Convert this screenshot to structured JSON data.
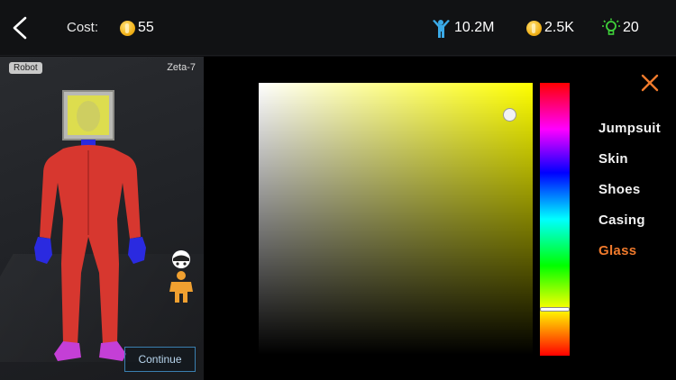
{
  "topbar": {
    "cost_label": "Cost:",
    "cost_value": "55",
    "fans_value": "10.2M",
    "coins_value": "2.5K",
    "ideas_value": "20",
    "icons": [
      "back-arrow-icon",
      "coin-icon",
      "fans-icon",
      "bulb-icon"
    ]
  },
  "preview": {
    "type_badge": "Robot",
    "character_name": "Zeta-7",
    "continue_label": "Continue",
    "icons": [
      "pose-icon"
    ]
  },
  "picker": {
    "hue_color": "#ffff00",
    "selected_hex": "#e8e8d8",
    "hue_position": 0.83
  },
  "parts": {
    "items": [
      {
        "label": "Jumpsuit",
        "active": false
      },
      {
        "label": "Skin",
        "active": false
      },
      {
        "label": "Shoes",
        "active": false
      },
      {
        "label": "Casing",
        "active": false
      },
      {
        "label": "Glass",
        "active": true
      }
    ],
    "active_color": "#f07a2c"
  },
  "colors": {
    "jumpsuit": "#d7372f",
    "skin": "#2a2ae0",
    "shoes": "#c43fd6",
    "casing": "#bfbfbf",
    "glass": "#e3e33c"
  }
}
